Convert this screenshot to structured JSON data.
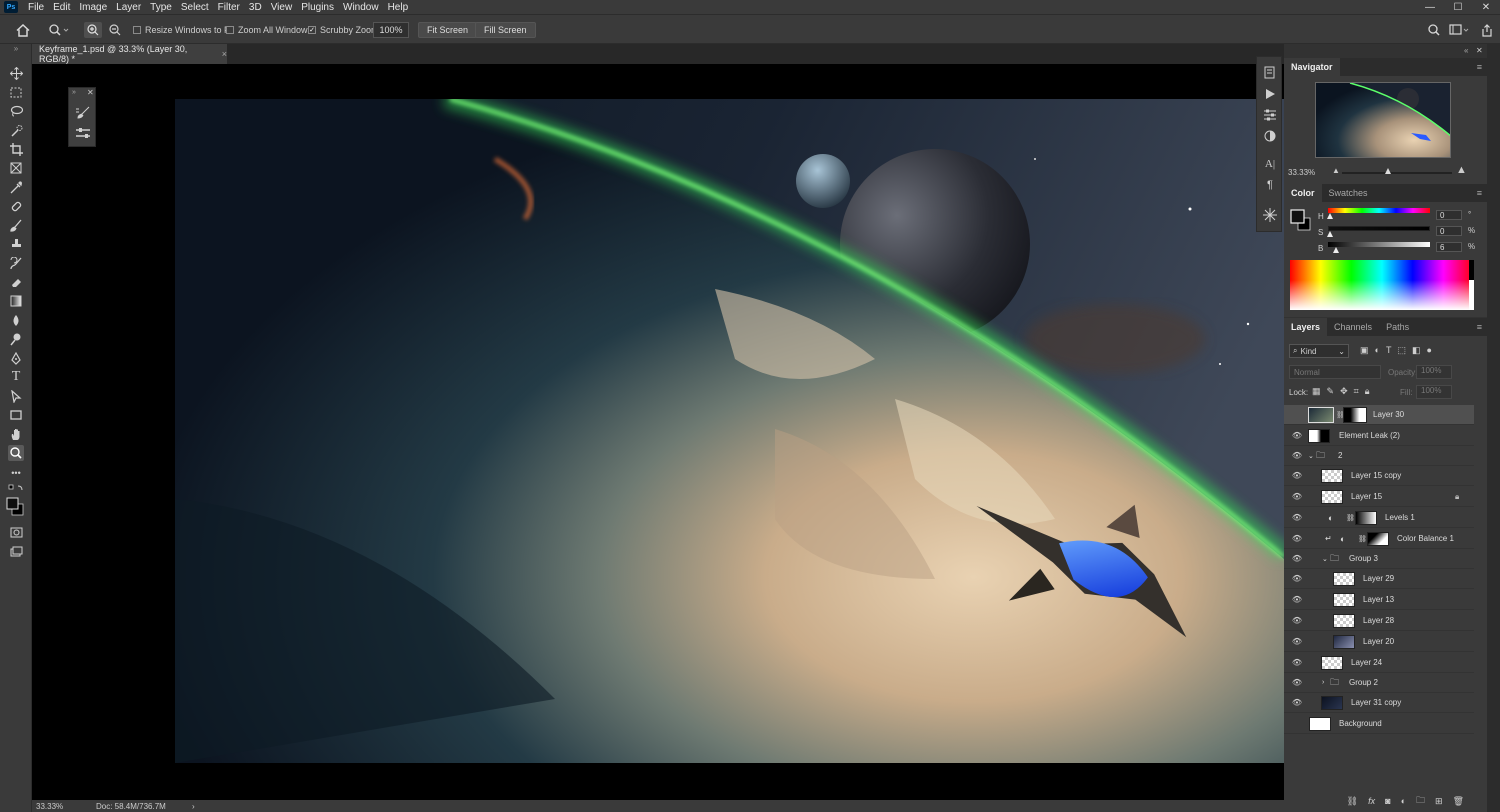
{
  "menubar": {
    "items": [
      "File",
      "Edit",
      "Image",
      "Layer",
      "Type",
      "Select",
      "Filter",
      "3D",
      "View",
      "Plugins",
      "Window",
      "Help"
    ],
    "window_controls": [
      "—",
      "☐",
      "✕"
    ]
  },
  "options": {
    "resize_windows_label": "Resize Windows to Fit",
    "zoom_all_label": "Zoom All Windows",
    "scrubby_zoom_label": "Scrubby Zoom",
    "zoom_value": "100%",
    "fit_screen_label": "Fit Screen",
    "fill_screen_label": "Fill Screen",
    "scrubby_checked": true
  },
  "document": {
    "tab_title": "Keyframe_1.psd @ 33.3% (Layer 30, RGB/8) *",
    "close": "×"
  },
  "status": {
    "zoom": "33.33%",
    "doc_size": "Doc: 58.4M/736.7M",
    "arrow": "›"
  },
  "navigator": {
    "title": "Navigator",
    "zoom": "33.33%",
    "slider_level": 0.42
  },
  "color": {
    "tabs": [
      "Color",
      "Swatches"
    ],
    "h_label": "H",
    "h_value": "0",
    "h_unit": "°",
    "s_label": "S",
    "s_value": "0",
    "s_unit": "%",
    "b_label": "B",
    "b_value": "6",
    "b_unit": "%"
  },
  "layers_panel": {
    "tabs": [
      "Layers",
      "Channels",
      "Paths"
    ],
    "filter_kind": "Kind",
    "blend_mode": "Normal",
    "opacity_label": "Opacity:",
    "opacity_value": "100%",
    "lock_label": "Lock:",
    "fill_label": "Fill:",
    "fill_value": "100%",
    "footer_icons": [
      "link-icon",
      "fx-icon",
      "mask-icon",
      "adjustment-icon",
      "group-icon",
      "new-layer-icon",
      "trash-icon"
    ],
    "footer_fx": "fx",
    "layers": [
      {
        "name": "Layer 30",
        "visible": false,
        "selected": true
      },
      {
        "name": "Element Leak (2)",
        "visible": true
      },
      {
        "name": "2",
        "visible": true,
        "type": "group"
      },
      {
        "name": "Layer 15 copy",
        "visible": true
      },
      {
        "name": "Layer 15",
        "visible": true,
        "locked": true
      },
      {
        "name": "Levels 1",
        "visible": true,
        "type": "adjustment"
      },
      {
        "name": "Color Balance 1",
        "visible": true,
        "type": "adjustment"
      },
      {
        "name": "Group 3",
        "visible": true,
        "type": "group"
      },
      {
        "name": "Layer 29",
        "visible": true
      },
      {
        "name": "Layer 13",
        "visible": true
      },
      {
        "name": "Layer 28",
        "visible": true
      },
      {
        "name": "Layer 20",
        "visible": true
      },
      {
        "name": "Layer 24",
        "visible": true
      },
      {
        "name": "Group 2",
        "visible": true,
        "type": "group"
      },
      {
        "name": "Layer 31 copy",
        "visible": true
      },
      {
        "name": "Background",
        "visible": false
      }
    ]
  }
}
